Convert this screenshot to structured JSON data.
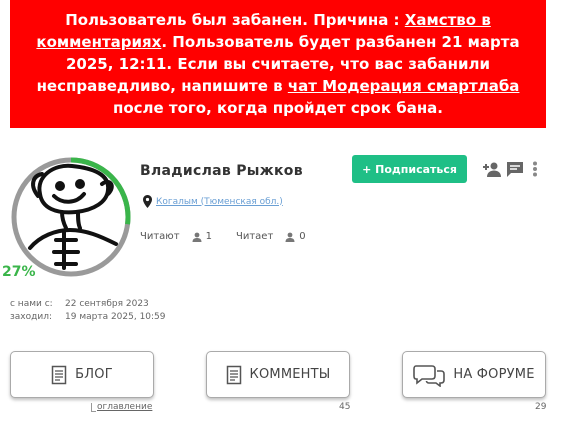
{
  "ban_banner": {
    "part1": "Пользователь был забанен. Причина : ",
    "reason_link": "Хамство в комментариях",
    "part2": ". Пользователь будет разбанен 21 марта 2025, 12:11. Если вы считаете, что вас забанили несправедливо, напишите в ",
    "moderation_link": "чат Модерация смартлаба",
    "part3": " после того, когда пройдет срок бана."
  },
  "profile": {
    "name": "Владислав Рыжков",
    "rating_percent": "27%",
    "rating_fraction": 0.27,
    "location": "Когалым (Тюменская обл.)",
    "subscribe_label": "+ Подписаться",
    "reads_label": "Читают",
    "reads_count": "1",
    "reading_label": "Читает",
    "reading_count": "0",
    "joined_label": "с нами с:",
    "joined_value": "22 сентября 2023",
    "visited_label": "заходил:",
    "visited_value": "19 марта 2025, 10:59"
  },
  "icons": {
    "add_friend": "add-user-icon",
    "message": "message-icon",
    "more": "more-vertical-icon",
    "location": "map-pin-icon",
    "person": "person-icon",
    "document": "document-icon",
    "chat": "speech-bubbles-icon"
  },
  "nav": {
    "blog_label": "БЛОГ",
    "comments_label": "КОММЕНТЫ",
    "forum_label": "НА ФОРУМЕ",
    "contents_label": "оглавление",
    "comments_count": "45",
    "forum_count": "29"
  },
  "colors": {
    "banner_bg": "#ff0000",
    "subscribe_bg": "#1fbf86",
    "rating_green": "#3ab54a",
    "link_blue": "#6a9fd4"
  }
}
